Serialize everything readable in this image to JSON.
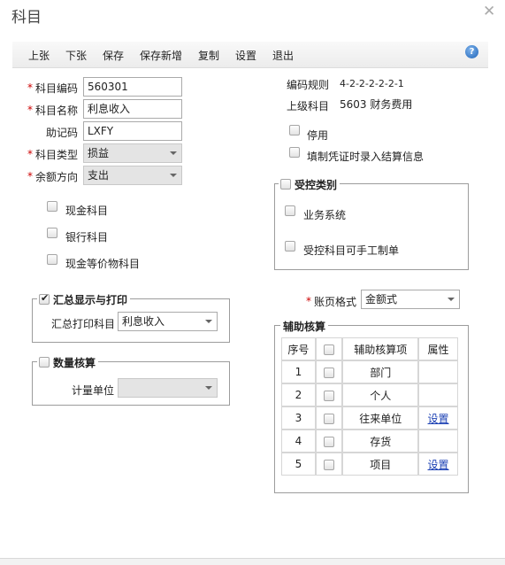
{
  "window": {
    "title": "科目"
  },
  "toolbar": {
    "items": [
      "上张",
      "下张",
      "保存",
      "保存新增",
      "复制",
      "设置",
      "退出"
    ]
  },
  "form": {
    "code": {
      "label": "科目编码",
      "value": "560301",
      "required": true
    },
    "name": {
      "label": "科目名称",
      "value": "利息收入",
      "required": true
    },
    "mnemonic": {
      "label": "助记码",
      "value": "LXFY"
    },
    "type": {
      "label": "科目类型",
      "value": "损益",
      "required": true
    },
    "balance": {
      "label": "余额方向",
      "value": "支出",
      "required": true
    }
  },
  "checks_left": [
    {
      "label": "现金科目",
      "checked": false
    },
    {
      "label": "银行科目",
      "checked": false
    },
    {
      "label": "现金等价物科目",
      "checked": false
    }
  ],
  "info": {
    "code_rule_label": "编码规则",
    "code_rule_value": "4-2-2-2-2-2-1",
    "parent_label": "上级科目",
    "parent_value": "5603 财务费用"
  },
  "checks_right": [
    {
      "label": "停用",
      "checked": false
    },
    {
      "label": "填制凭证时录入结算信息",
      "checked": false
    }
  ],
  "controlled": {
    "legend": "受控类别",
    "checked": false,
    "items": [
      {
        "label": "业务系统",
        "checked": false
      },
      {
        "label": "受控科目可手工制单",
        "checked": false
      }
    ]
  },
  "summary_print": {
    "legend": "汇总显示与打印",
    "checked": true,
    "field_label": "汇总打印科目",
    "field_value": "利息收入"
  },
  "quantity": {
    "legend": "数量核算",
    "checked": false,
    "field_label": "计量单位",
    "field_value": ""
  },
  "ledger_format": {
    "label": "账页格式",
    "value": "金额式",
    "required": true
  },
  "auxiliary": {
    "legend": "辅助核算",
    "headers": {
      "seq": "序号",
      "item": "辅助核算项",
      "attr": "属性"
    },
    "rows": [
      {
        "seq": "1",
        "item": "部门",
        "attr": ""
      },
      {
        "seq": "2",
        "item": "个人",
        "attr": ""
      },
      {
        "seq": "3",
        "item": "往来单位",
        "attr": "设置"
      },
      {
        "seq": "4",
        "item": "存货",
        "attr": ""
      },
      {
        "seq": "5",
        "item": "项目",
        "attr": "设置"
      }
    ]
  },
  "icons": {
    "close": "close-icon",
    "help": "help-icon"
  }
}
